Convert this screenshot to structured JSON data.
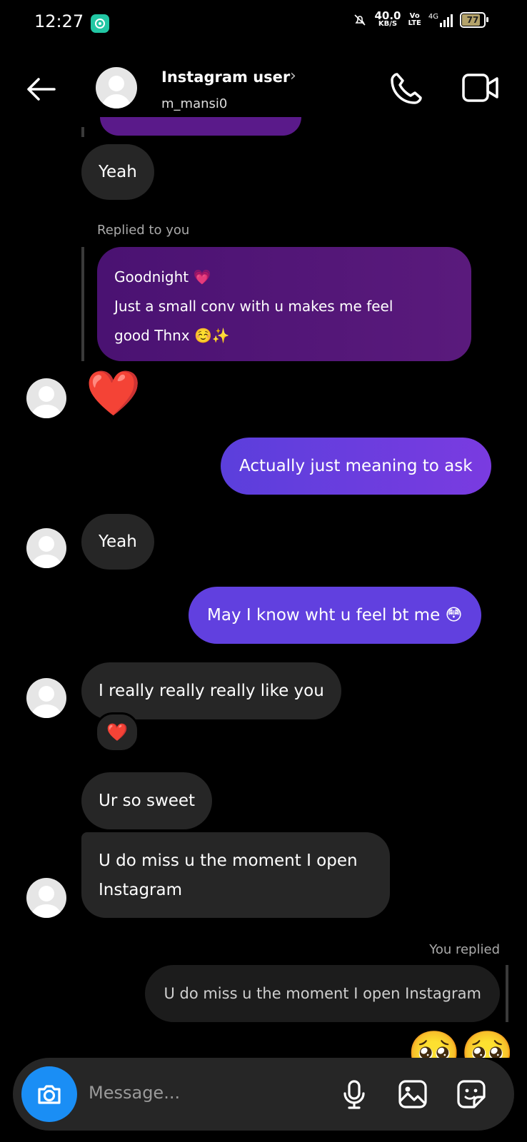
{
  "status_bar": {
    "time": "12:27",
    "speed_value": "40.0",
    "speed_unit": "KB/S",
    "volte_top": "Vo",
    "volte_bottom": "LTE",
    "network": "4G",
    "battery": "77"
  },
  "header": {
    "name": "Instagram user",
    "handle": "m_mansi0",
    "chevron": "›"
  },
  "messages": {
    "m1": "Yeah",
    "reply_label": "Replied to you",
    "reply_line1": "Goodnight 💗",
    "reply_line2": "Just a small conv with u makes me feel",
    "reply_line3": "good Thnx ☺️✨",
    "heart": "❤️",
    "m2_out": "Actually just meaning to ask",
    "m3": "Yeah",
    "m4_out": "May I know wht u feel bt me 😳",
    "m5": "I really really really like you",
    "m5_reaction": "❤️",
    "m6": "Ur so sweet",
    "m7_line1": "U do miss u the moment I open",
    "m7_line2": "Instagram",
    "you_replied_label": "You replied",
    "quoted": "U do miss u the moment I open Instagram",
    "emojis": "🥺🥺"
  },
  "composer": {
    "placeholder": "Message..."
  },
  "colors": {
    "accent": "#1a8ef5",
    "outgoing": "#6140df",
    "incoming": "#262626"
  },
  "icons": [
    "back-arrow-icon",
    "phone-icon",
    "video-icon",
    "camera-icon",
    "microphone-icon",
    "gallery-icon",
    "sticker-icon"
  ]
}
